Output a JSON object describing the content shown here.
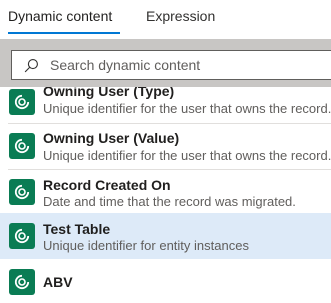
{
  "tabs": [
    {
      "label": "Dynamic content",
      "active": true
    },
    {
      "label": "Expression",
      "active": false
    }
  ],
  "search": {
    "placeholder": "Search dynamic content"
  },
  "items": [
    {
      "title": "Owning User (Type)",
      "description": "Unique identifier for the user that owns the record.",
      "icon": "dataverse-icon"
    },
    {
      "title": "Owning User (Value)",
      "description": "Unique identifier for the user that owns the record.",
      "icon": "dataverse-icon"
    },
    {
      "title": "Record Created On",
      "description": "Date and time that the record was migrated.",
      "icon": "dataverse-icon"
    },
    {
      "title": "Test Table",
      "description": "Unique identifier for entity instances",
      "icon": "dataverse-icon",
      "highlighted": true
    },
    {
      "title": "ABV",
      "description": "",
      "icon": "dataverse-icon"
    }
  ],
  "colors": {
    "accent": "#0078d4",
    "icon_bg": "#0a7c54",
    "highlight": "#ddeaf8"
  }
}
